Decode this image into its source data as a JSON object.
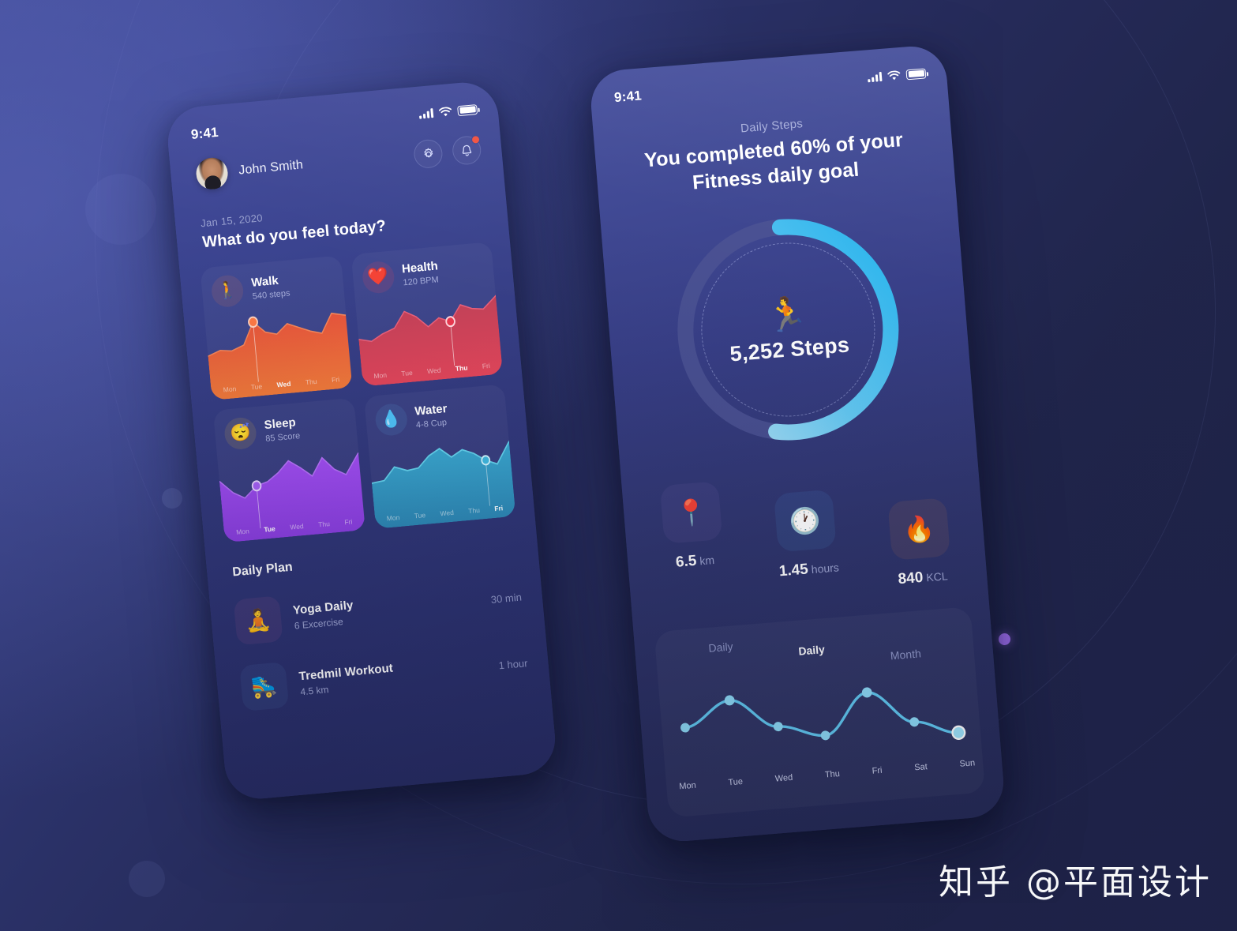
{
  "background": {
    "accent_purple": "#9a6be8",
    "base_color": "#272e63"
  },
  "watermark": {
    "text": "知乎 @平面设计"
  },
  "left_phone": {
    "status": {
      "time": "9:41",
      "signal_icon": "signal-bars-icon",
      "wifi_icon": "wifi-icon",
      "battery_icon": "battery-full-icon"
    },
    "user": {
      "name": "John Smith",
      "avatar_icon": "avatar"
    },
    "actions": {
      "settings_icon": "gear-icon",
      "notifications_icon": "bell-icon",
      "has_badge": true
    },
    "date": "Jan 15, 2020",
    "question": "What do you feel today?",
    "cards": [
      {
        "key": "walk",
        "title": "Walk",
        "subtitle": "540 steps",
        "icon": "🚶",
        "icon_name": "walking-person-icon",
        "accent": "#f2663c",
        "active_day": "Wed",
        "days": [
          "Mon",
          "Tue",
          "Wed",
          "Thu",
          "Fri"
        ]
      },
      {
        "key": "health",
        "title": "Health",
        "subtitle": "120 BPM",
        "icon": "❤️",
        "icon_name": "heartbeat-icon",
        "accent": "#e8384f",
        "active_day": "Thu",
        "days": [
          "Mon",
          "Tue",
          "Wed",
          "Thu",
          "Fri"
        ]
      },
      {
        "key": "sleep",
        "title": "Sleep",
        "subtitle": "85 Score",
        "icon": "😴",
        "icon_name": "sleeping-face-icon",
        "accent": "#9b4df0",
        "active_day": "Tue",
        "days": [
          "Mon",
          "Tue",
          "Wed",
          "Thu",
          "Fri"
        ]
      },
      {
        "key": "water",
        "title": "Water",
        "subtitle": "4-8 Cup",
        "icon": "💧",
        "icon_name": "water-drop-icon",
        "accent": "#3bb3d6",
        "active_day": "Fri",
        "days": [
          "Mon",
          "Tue",
          "Wed",
          "Thu",
          "Fri"
        ]
      }
    ],
    "daily_plan": {
      "title": "Daily Plan",
      "items": [
        {
          "name": "Yoga Daily",
          "meta": "6 Excercise",
          "duration": "30 min",
          "icon": "🧘",
          "icon_name": "yoga-pose-icon"
        },
        {
          "name": "Tredmil Workout",
          "meta": "4.5 km",
          "duration": "1 hour",
          "icon": "🛼",
          "icon_name": "treadmill-icon"
        }
      ]
    }
  },
  "right_phone": {
    "status": {
      "time": "9:41",
      "signal_icon": "signal-bars-icon",
      "wifi_icon": "wifi-icon",
      "battery_icon": "battery-full-icon"
    },
    "label": "Daily Steps",
    "headline": "You completed 60% of your Fitness daily goal",
    "ring": {
      "progress_percent": 60,
      "steps_value": "5,252 Steps",
      "emoji": "🏃",
      "icon_name": "running-person-icon",
      "track_color": "#4b5391",
      "arc_color_start": "#9fd9f5",
      "arc_color_end": "#30b6ec"
    },
    "stats": [
      {
        "value": "6.5",
        "unit": "km",
        "icon": "📍",
        "icon_name": "map-pins-icon"
      },
      {
        "value": "1.45",
        "unit": "hours",
        "icon": "🕐",
        "icon_name": "clock-icon"
      },
      {
        "value": "840",
        "unit": "KCL",
        "icon": "🔥",
        "icon_name": "fire-icon"
      }
    ],
    "chart_card": {
      "tabs": [
        {
          "label": "Daily",
          "active": false
        },
        {
          "label": "Daily",
          "active": true
        },
        {
          "label": "Month",
          "active": false
        }
      ]
    }
  },
  "chart_data": [
    {
      "type": "line",
      "id": "weekly-steps-line",
      "title": "",
      "categories": [
        "Mon",
        "Tue",
        "Wed",
        "Thu",
        "Fri",
        "Sat",
        "Sun"
      ],
      "values": [
        48,
        78,
        44,
        34,
        76,
        36,
        24
      ],
      "ylabel": "",
      "xlabel": "",
      "ylim": [
        0,
        100
      ],
      "grid": true,
      "legend": "none",
      "line_color": "#56c5f0",
      "point_color": "#9fe0fa",
      "active_point_index": 6
    },
    {
      "type": "area",
      "id": "walk-card-chart",
      "categories": [
        "Mon",
        "Tue",
        "Wed",
        "Thu",
        "Fri"
      ],
      "values": [
        46,
        40,
        50,
        45,
        84,
        70,
        66,
        80,
        72,
        66,
        60,
        88,
        82
      ],
      "ylim": [
        0,
        100
      ],
      "marker_index": 4,
      "marker_label": "Wed",
      "fill_top": "#e8553c",
      "fill_bottom": "#f07a3a"
    },
    {
      "type": "area",
      "id": "health-card-chart",
      "categories": [
        "Mon",
        "Tue",
        "Wed",
        "Thu",
        "Fri"
      ],
      "values": [
        52,
        48,
        56,
        62,
        82,
        74,
        60,
        70,
        64,
        84,
        78,
        76,
        92
      ],
      "ylim": [
        0,
        100
      ],
      "marker_index": 8,
      "marker_label": "Thu",
      "fill_top": "#cf4456",
      "fill_bottom": "#e0455a"
    },
    {
      "type": "area",
      "id": "sleep-card-chart",
      "categories": [
        "Mon",
        "Tue",
        "Wed",
        "Thu",
        "Fri"
      ],
      "values": [
        70,
        52,
        44,
        58,
        62,
        72,
        86,
        74,
        64,
        86,
        70,
        62,
        88
      ],
      "ylim": [
        0,
        100
      ],
      "marker_index": 3,
      "marker_label": "Tue",
      "fill_top": "#a14ef2",
      "fill_bottom": "#8b3fe0"
    },
    {
      "type": "area",
      "id": "water-card-chart",
      "categories": [
        "Mon",
        "Tue",
        "Wed",
        "Thu",
        "Fri"
      ],
      "values": [
        52,
        54,
        68,
        62,
        64,
        76,
        84,
        72,
        80,
        74,
        66,
        62,
        86
      ],
      "ylim": [
        0,
        100
      ],
      "marker_index": 10,
      "marker_label": "Fri",
      "fill_top": "#3aa7cf",
      "fill_bottom": "#2d8bb8"
    }
  ]
}
